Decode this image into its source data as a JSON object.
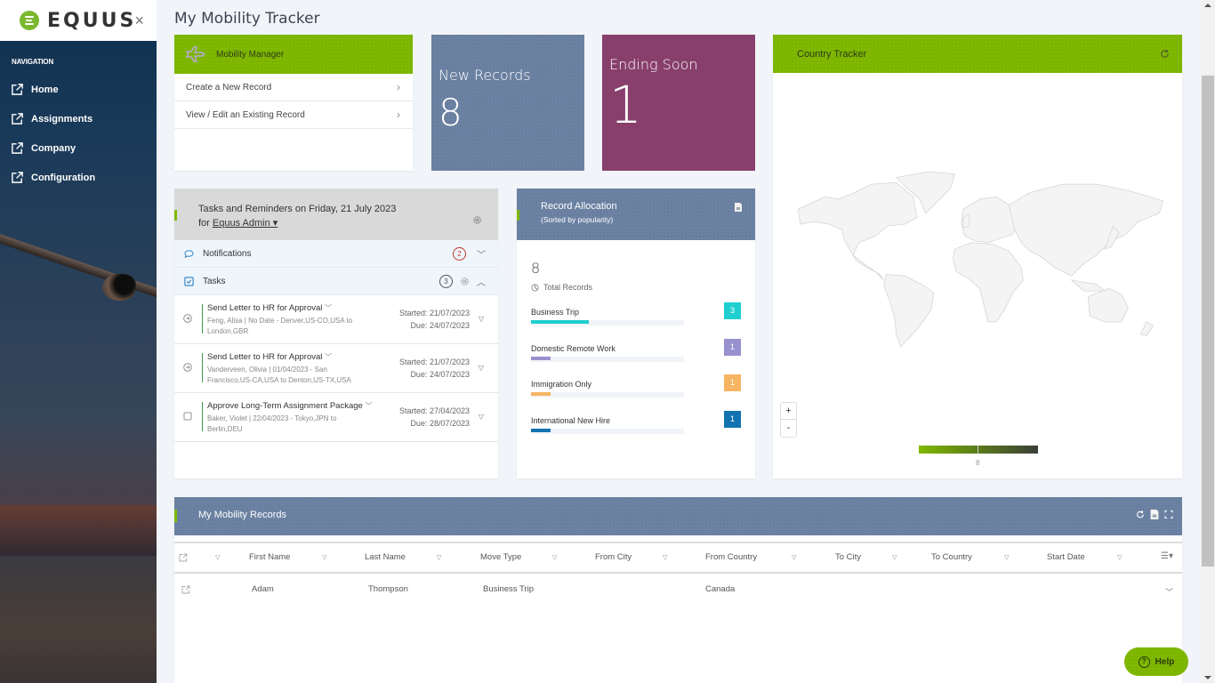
{
  "app": {
    "brand": "EQUUS",
    "page_title": "My Mobility Tracker"
  },
  "sidebar": {
    "heading": "NAVIGATION",
    "close_icon": "×",
    "items": [
      {
        "label": "Home",
        "icon": "external-link-icon"
      },
      {
        "label": "Assignments",
        "icon": "external-link-icon"
      },
      {
        "label": "Company",
        "icon": "external-link-icon"
      },
      {
        "label": "Configuration",
        "icon": "external-link-icon"
      }
    ]
  },
  "mobility_manager": {
    "title": "Mobility Manager",
    "icon": "airplane-icon",
    "links": [
      {
        "label": "Create a New Record",
        "chevron": "›"
      },
      {
        "label": "View / Edit an Existing Record",
        "chevron": "›"
      }
    ]
  },
  "tiles": {
    "new_records": {
      "label": "New Records",
      "value": "8",
      "color": "#6c82a3"
    },
    "ending_soon": {
      "label": "Ending Soon",
      "value": "1",
      "color": "#883f6b"
    }
  },
  "country_tracker": {
    "title": "Country Tracker",
    "zoom_in": "+",
    "zoom_out": "-",
    "legend_value": "8",
    "legend_colors": [
      "#7fb800",
      "#3b3f3a"
    ]
  },
  "tasks_panel": {
    "title_line1": "Tasks and Reminders on Friday, 21 July 2023",
    "for_label": "for",
    "owner": "Equus Admin",
    "notifications": {
      "label": "Notifications",
      "count": "2"
    },
    "tasks": {
      "label": "Tasks",
      "count": "3"
    },
    "items": [
      {
        "title": "Send Letter to HR for Approval",
        "desc": "Feng, Alisa   |   No Date - Denver,US-CO,USA to London,GBR",
        "started": "Started: 21/07/2023",
        "due": "Due: 24/07/2023",
        "icon": "arrow-circle-icon"
      },
      {
        "title": "Send Letter to HR for Approval",
        "desc": "Vanderveen, Olivia   |   01/04/2023 - San Francisco,US-CA,USA to Denton,US-TX,USA",
        "started": "Started: 21/07/2023",
        "due": "Due: 24/07/2023",
        "icon": "arrow-circle-icon"
      },
      {
        "title": "Approve Long-Term Assignment Package",
        "desc": "Baker, Violet   |   22/04/2023 - Tokyo,JPN to Berlin,DEU",
        "started": "Started: 27/04/2023",
        "due": "Due: 28/07/2023",
        "icon": "checkbox-icon"
      }
    ]
  },
  "record_allocation": {
    "title": "Record Allocation",
    "subtitle": "(Sorted by popularity)",
    "total": "8",
    "total_label": "Total Records",
    "rows": [
      {
        "label": "Business Trip",
        "count": "3",
        "fraction": 0.375,
        "color": "#1fcfcf"
      },
      {
        "label": "Domestic Remote Work",
        "count": "1",
        "fraction": 0.125,
        "color": "#9891d0"
      },
      {
        "label": "Immigration Only",
        "count": "1",
        "fraction": 0.125,
        "color": "#f7b463"
      },
      {
        "label": "International New Hire",
        "count": "1",
        "fraction": 0.125,
        "color": "#1273b0"
      }
    ]
  },
  "records": {
    "title": "My Mobility Records",
    "columns": [
      "First Name",
      "Last Name",
      "Move Type",
      "From City",
      "From Country",
      "To City",
      "To Country",
      "Start Date"
    ],
    "rows": [
      {
        "first_name": "Adam",
        "last_name": "Thompson",
        "move_type": "Business Trip",
        "from_city": "",
        "from_country": "Canada",
        "to_city": "",
        "to_country": "",
        "start_date": ""
      }
    ]
  },
  "help": {
    "label": "Help",
    "icon": "?"
  }
}
